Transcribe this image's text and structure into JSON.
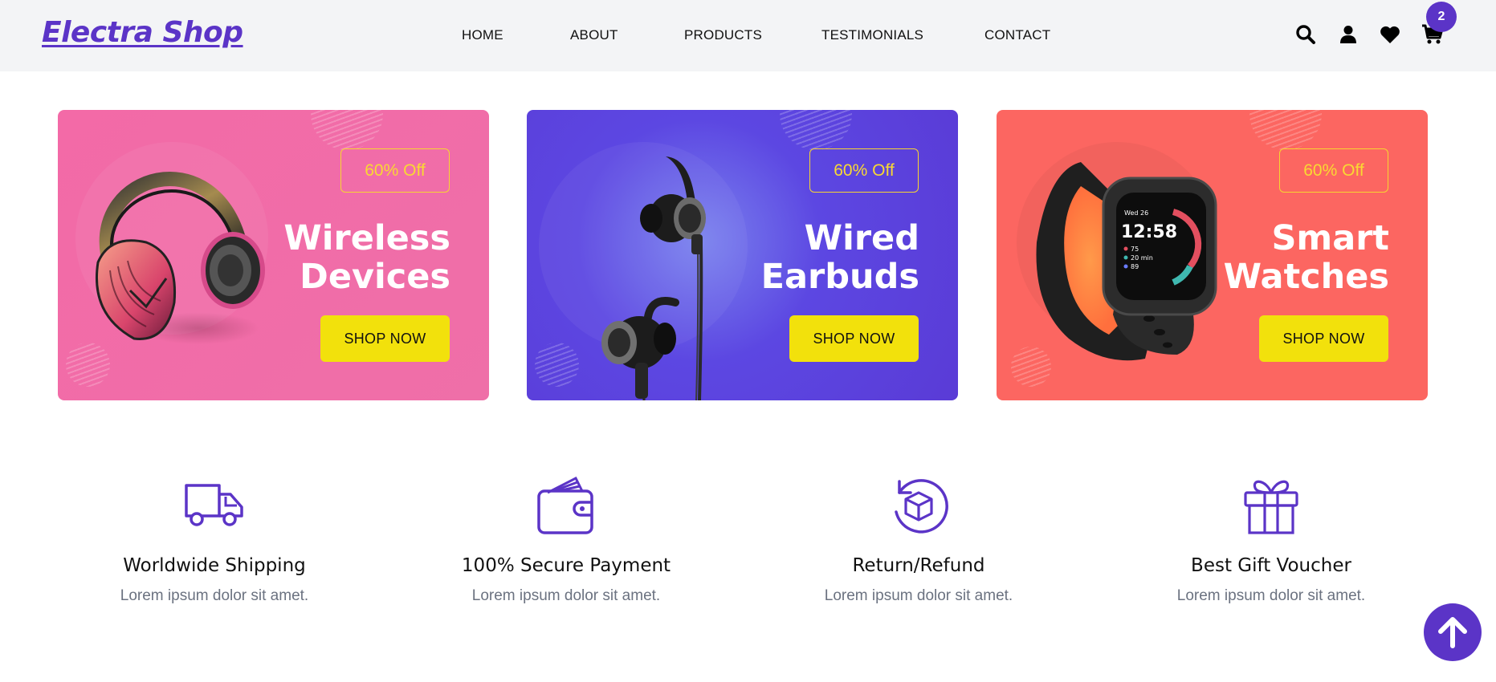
{
  "header": {
    "logo": "Electra Shop",
    "nav": [
      "HOME",
      "ABOUT",
      "PRODUCTS",
      "TESTIMONIALS",
      "CONTACT"
    ],
    "cart_count": "2",
    "icons": [
      "search-icon",
      "user-icon",
      "heart-icon",
      "cart-icon"
    ]
  },
  "banners": [
    {
      "discount": "60% Off",
      "title_line1": "Wireless",
      "title_line2": "Devices",
      "button": "SHOP NOW",
      "image": "headphones",
      "color": "#f06aa8"
    },
    {
      "discount": "60% Off",
      "title_line1": "Wired",
      "title_line2": "Earbuds",
      "button": "SHOP NOW",
      "image": "earbuds",
      "color": "#5b3fdc"
    },
    {
      "discount": "60% Off",
      "title_line1": "Smart",
      "title_line2": "Watches",
      "button": "SHOP NOW",
      "image": "smart-watch",
      "color": "#fc6661"
    }
  ],
  "features": [
    {
      "title": "Worldwide Shipping",
      "desc": "Lorem ipsum dolor sit amet.",
      "icon": "truck-icon"
    },
    {
      "title": "100% Secure Payment",
      "desc": "Lorem ipsum dolor sit amet.",
      "icon": "wallet-icon"
    },
    {
      "title": "Return/Refund",
      "desc": "Lorem ipsum dolor sit amet.",
      "icon": "return-box-icon"
    },
    {
      "title": "Best Gift Voucher",
      "desc": "Lorem ipsum dolor sit amet.",
      "icon": "gift-icon"
    }
  ],
  "watch_screen": {
    "day": "Wed 26",
    "time": "12:58",
    "stat1": "75",
    "stat2": "20 min",
    "stat3": "89"
  },
  "colors": {
    "accent": "#5b34c7",
    "button": "#f2e10c",
    "discount": "#f9d932"
  }
}
